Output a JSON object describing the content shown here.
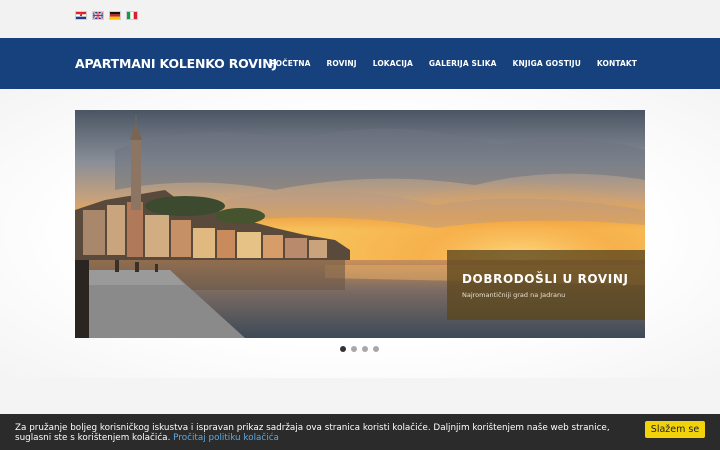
{
  "languages": [
    {
      "name": "Hrvatski",
      "icon": "croatian-flag-icon"
    },
    {
      "name": "English",
      "icon": "uk-flag-icon"
    },
    {
      "name": "Deutsch",
      "icon": "german-flag-icon"
    },
    {
      "name": "Italiano",
      "icon": "italian-flag-icon"
    }
  ],
  "header": {
    "brand": "APARTMANI KOLENKO ROVINJ",
    "menu": [
      "POČETNA",
      "ROVINJ",
      "LOKACIJA",
      "GALERIJA SLIKA",
      "KNJIGA GOSTIJU",
      "KONTAKT"
    ]
  },
  "slider": {
    "caption_title": "DOBRODOŠLI U ROVINJ",
    "caption_subtitle": "Najromantičniji grad na Jadranu",
    "slide_count": 4,
    "active_slide": 1
  },
  "cookie": {
    "text": "Za pružanje boljeg korisničkog iskustva i ispravan prikaz sadržaja ova stranica koristi kolačiće. Daljnjim korištenjem naše web stranice, suglasni ste s korištenjem kolačića. ",
    "link": "Pročitaj politiku kolačića",
    "button": "Slažem se"
  },
  "colors": {
    "navbar": "#16417c",
    "cookie_bar": "#2b2b2b",
    "cookie_button": "#f2d30a",
    "cookie_link": "#5fa9df"
  }
}
